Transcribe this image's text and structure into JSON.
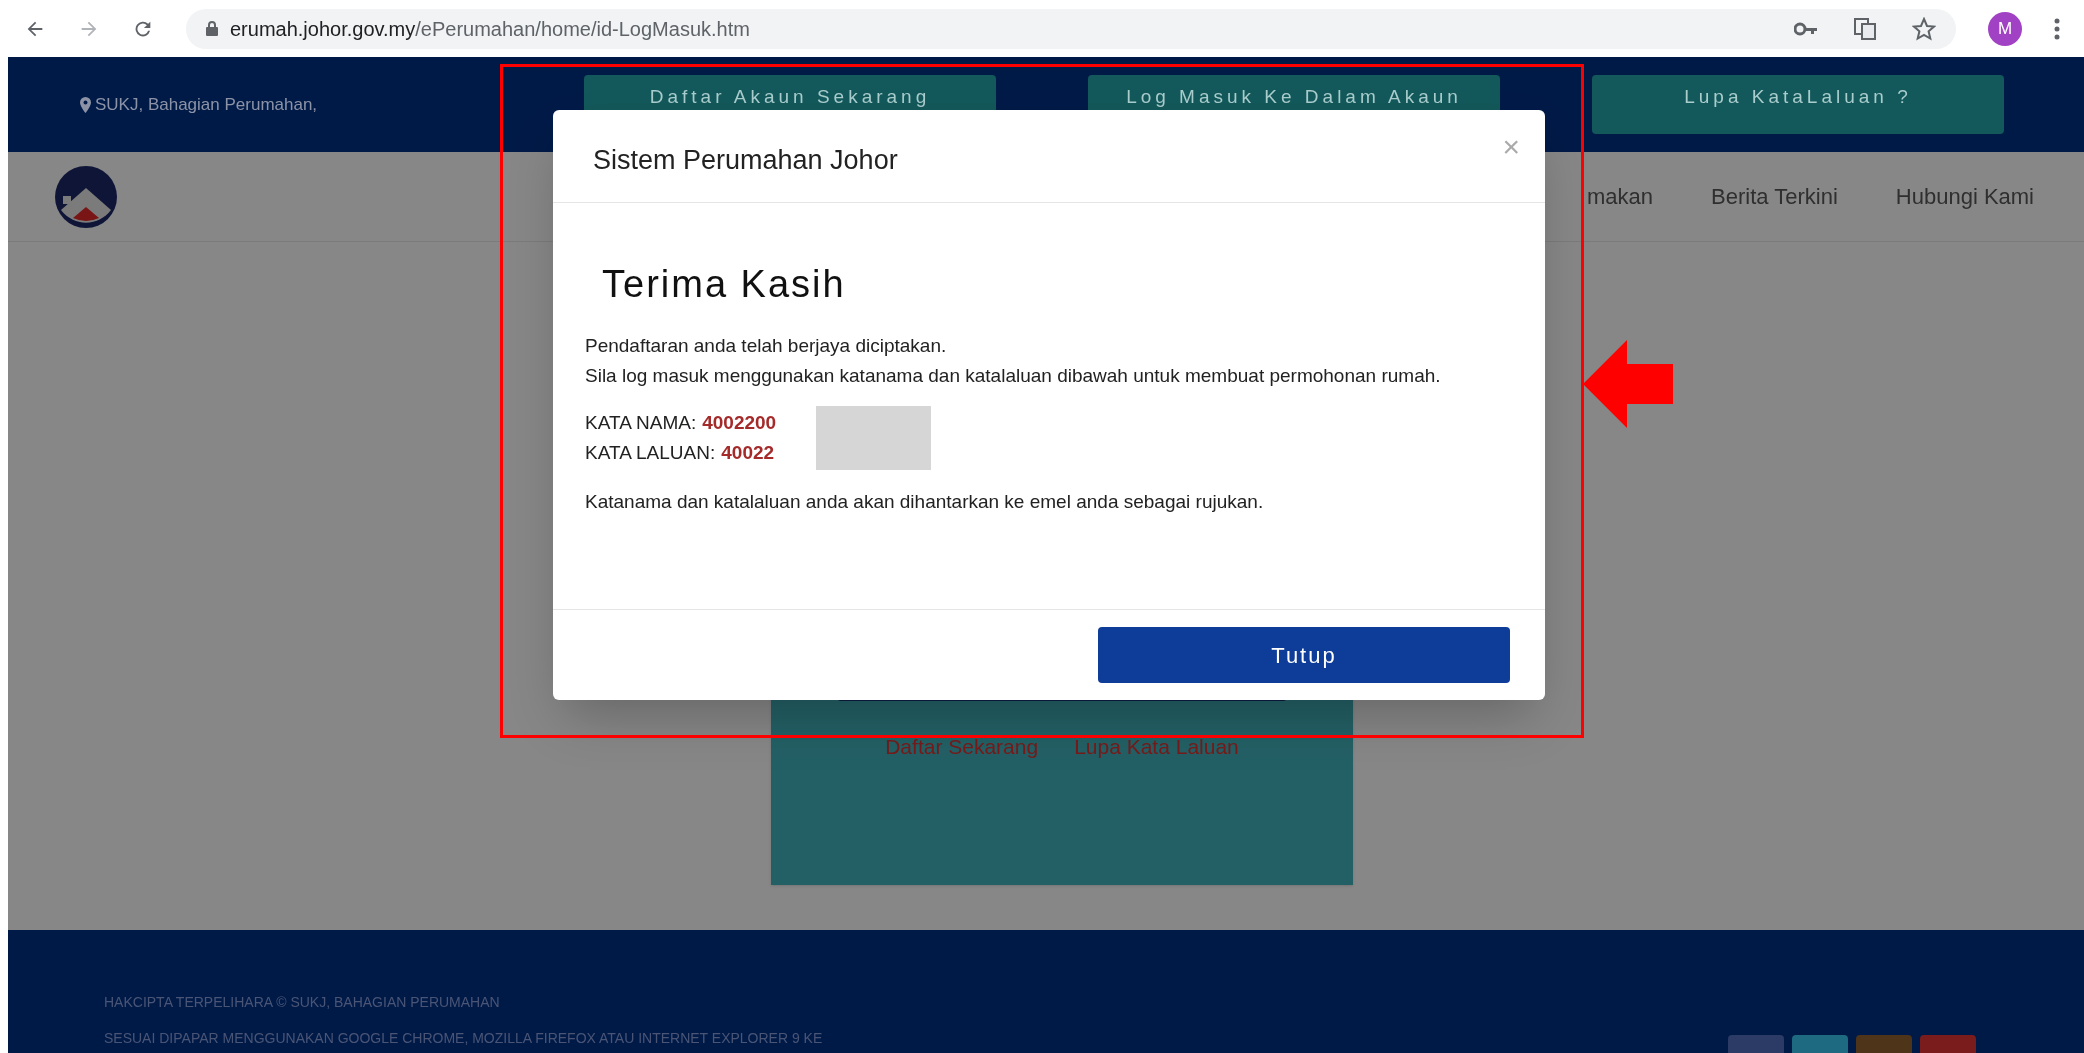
{
  "browser": {
    "url_host": "erumah.johor.gov.my",
    "url_path": "/ePerumahan/home/id-LogMasuk.htm",
    "profile_initial": "M"
  },
  "header": {
    "location": "SUKJ, Bahagian Perumahan,",
    "buttons": [
      "Daftar Akaun Sekarang",
      "Log Masuk Ke Dalam Akaun",
      "Lupa KataLaluan ?"
    ]
  },
  "nav": {
    "items": [
      "makan",
      "Berita Terkini",
      "Hubungi Kami"
    ]
  },
  "login_card": {
    "links": [
      "Daftar Sekarang",
      "Lupa Kata Laluan"
    ]
  },
  "footer": {
    "lines": [
      "HAKCIPTA TERPELIHARA © SUKJ, BAHAGIAN PERUMAHAN",
      "SESUAI DIPAPAR MENGGUNAKAN GOOGLE CHROME, MOZILLA FIREFOX ATAU INTERNET EXPLORER 9 KE"
    ]
  },
  "modal": {
    "title": "Sistem Perumahan Johor",
    "close": "×",
    "heading": "Terima Kasih",
    "paragraphs": [
      "Pendaftaran anda telah berjaya diciptakan.",
      "Sila log masuk menggunakan katanama dan katalaluan dibawah untuk membuat permohonan rumah."
    ],
    "credentials": [
      {
        "label": "KATA NAMA:",
        "value": "4002200"
      },
      {
        "label": "KATA LALUAN:",
        "value": "40022"
      }
    ],
    "note": "Katanama dan katalaluan anda akan dihantarkan ke emel anda sebagai rujukan.",
    "button": "Tutup"
  }
}
